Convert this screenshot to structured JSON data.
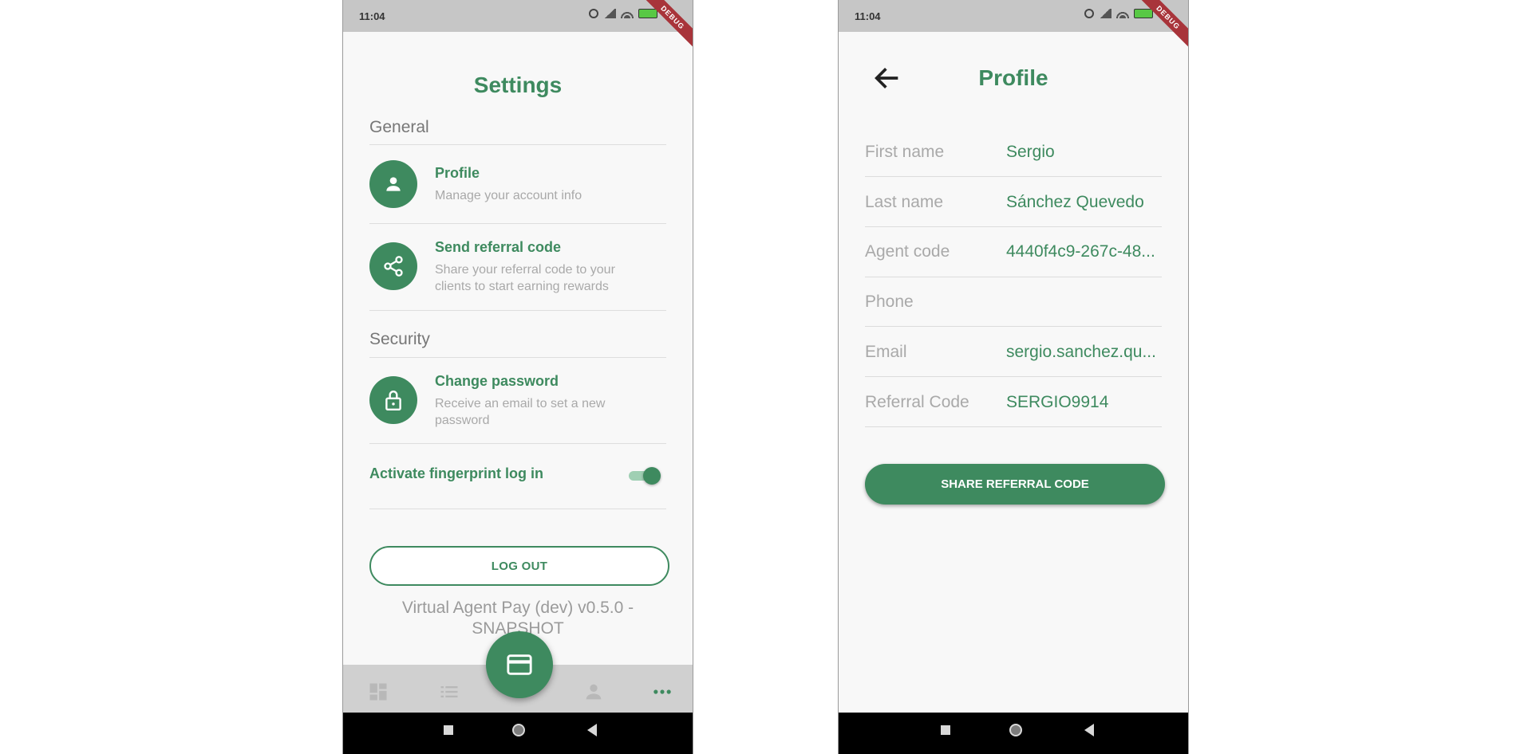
{
  "status_bar": {
    "time": "11:04",
    "debug_label": "DEBUG"
  },
  "settings": {
    "title": "Settings",
    "general_label": "General",
    "security_label": "Security",
    "items": [
      {
        "title": "Profile",
        "subtitle": "Manage your account info",
        "icon": "person-icon"
      },
      {
        "title": "Send referral code",
        "subtitle": "Share your referral code to your clients to start earning rewards",
        "icon": "share-icon"
      },
      {
        "title": "Change password",
        "subtitle": "Receive an email to set a new password",
        "icon": "lock-icon"
      }
    ],
    "fingerprint": {
      "label": "Activate fingerprint log in",
      "enabled": true
    },
    "logout_label": "LOG OUT",
    "version": "Virtual Agent Pay (dev) v0.5.0 - SNAPSHOT",
    "bottom_nav": {
      "icons": [
        "dashboard-icon",
        "list-icon",
        "card-icon",
        "person-icon",
        "more-icon"
      ],
      "active": "more-icon"
    }
  },
  "profile": {
    "title": "Profile",
    "fields": [
      {
        "label": "First name",
        "value": "Sergio"
      },
      {
        "label": "Last name",
        "value": "Sánchez Quevedo"
      },
      {
        "label": "Agent code",
        "value": "4440f4c9-267c-48..."
      },
      {
        "label": "Phone",
        "value": ""
      },
      {
        "label": "Email",
        "value": "sergio.sanchez.qu..."
      },
      {
        "label": "Referral Code",
        "value": "SERGIO9914"
      }
    ],
    "share_label": "SHARE REFERRAL CODE"
  },
  "colors": {
    "accent": "#3e8a5f",
    "muted": "#a9a9a9",
    "background": "#f8f8f8"
  }
}
